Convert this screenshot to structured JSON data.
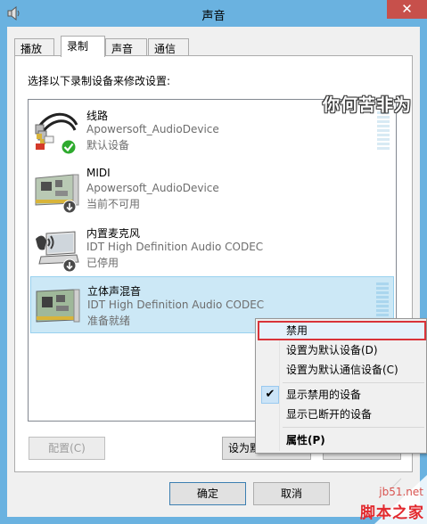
{
  "window": {
    "title": "声音",
    "close_label": "✕"
  },
  "tabs": [
    {
      "label": "播放"
    },
    {
      "label": "录制"
    },
    {
      "label": "声音"
    },
    {
      "label": "通信"
    }
  ],
  "instruction": "选择以下录制设备来修改设置:",
  "devices": [
    {
      "name": "线路",
      "driver": "Apowersoft_AudioDevice",
      "status": "默认设备",
      "icon": "line-in-cable-icon",
      "badge": "default-check"
    },
    {
      "name": "MIDI",
      "driver": "Apowersoft_AudioDevice",
      "status": "当前不可用",
      "icon": "midi-card-icon",
      "badge": "down-arrow"
    },
    {
      "name": "内置麦克风",
      "driver": "IDT High Definition Audio CODEC",
      "status": "已停用",
      "icon": "microphone-laptop-icon",
      "badge": "down-arrow"
    },
    {
      "name": "立体声混音",
      "driver": "IDT High Definition Audio CODEC",
      "status": "准备就绪",
      "icon": "sound-card-icon",
      "badge": "none"
    }
  ],
  "buttons": {
    "configure": "配置(C)",
    "set_default": "设为默",
    "ok": "确定",
    "cancel": "取消"
  },
  "context_menu": {
    "items": [
      {
        "label": "禁用"
      },
      {
        "label": "设置为默认设备(D)"
      },
      {
        "label": "设置为默认通信设备(C)"
      },
      {
        "label": "显示禁用的设备"
      },
      {
        "label": "显示已断开的设备"
      },
      {
        "label": "属性(P)"
      }
    ]
  },
  "overlay_caption": "你何苦非为",
  "watermark": {
    "domain": "jb51.net",
    "brand": "脚本之家"
  },
  "colors": {
    "title_bar": "#6ab2e0",
    "close_button": "#c7504b",
    "selection": "#cce8f6",
    "menu_highlight_border": "#d9343a",
    "default_check": "#2eaa2e"
  }
}
